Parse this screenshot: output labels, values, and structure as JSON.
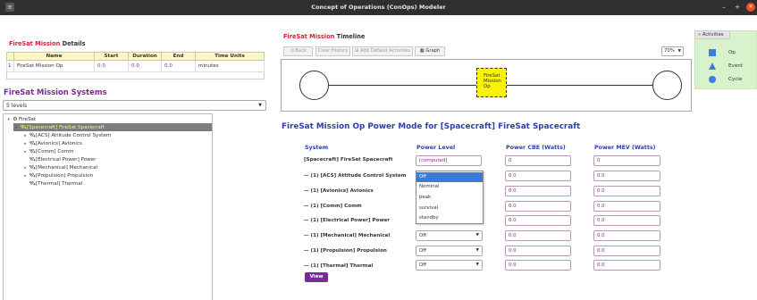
{
  "window": {
    "title": "Concept of Operations (ConOps) Modeler",
    "minimize": "–",
    "maximize": "+",
    "close": "✕"
  },
  "details": {
    "heading_prefix": "FireSat Mission",
    "heading_suffix": "Details",
    "columns": [
      "Name",
      "Start",
      "Duration",
      "End",
      "Time Units"
    ],
    "row": {
      "index": "1",
      "name": "FireSat Mission Op",
      "start": "0.0",
      "duration": "0.0",
      "end": "0.0",
      "units": "minutes"
    }
  },
  "systems": {
    "heading": "FireSat Mission Systems",
    "levels": "5 levels",
    "tree": [
      {
        "label": "FireSat",
        "toggle": "▾",
        "icon": "⚙"
      },
      {
        "label": "[Spacecraft] FireSat Spacecraft",
        "toggle": "▾",
        "icon": "🛰"
      },
      {
        "label": "[ACS] Attitude Control System",
        "toggle": "▸",
        "icon": "🛰"
      },
      {
        "label": "[Avionics] Avionics",
        "toggle": "▸",
        "icon": "🛰"
      },
      {
        "label": "[Comm] Comm",
        "toggle": "▸",
        "icon": "🛰"
      },
      {
        "label": "[Electrical Power] Power",
        "toggle": "",
        "icon": "🛰"
      },
      {
        "label": "[Mechanical] Mechanical",
        "toggle": "▸",
        "icon": "🛰"
      },
      {
        "label": "[Propulsion] Propulsion",
        "toggle": "▸",
        "icon": "🛰"
      },
      {
        "label": "[Thermal] Thermal",
        "toggle": "",
        "icon": "🛰"
      }
    ]
  },
  "timeline": {
    "heading_prefix": "FireSat Mission",
    "heading_suffix": "Timeline",
    "buttons": {
      "back": "Back",
      "clear": "Clear History",
      "add": "Add Default Activities",
      "graph": "Graph"
    },
    "zoom": "70%",
    "activity": [
      "FireSat",
      "Mission",
      "Op"
    ]
  },
  "palette": {
    "tab": "Activities",
    "items": [
      "Op",
      "Event",
      "Cycle"
    ]
  },
  "power_mode": {
    "heading": "FireSat Mission Op Power Mode for [Spacecraft] FireSat Spacecraft",
    "col_system": "System",
    "col_level": "Power Level",
    "col_cbe": "Power CBE (Watts)",
    "col_mev": "Power MEV (Watts)",
    "rows": [
      {
        "system": "[Spacecraft] FireSat Spacecraft",
        "level": "[computed]",
        "cbe": "0",
        "mev": "0"
      },
      {
        "system": "— (1) [ACS] Attitude Control System",
        "level": "Off",
        "cbe": "0.0",
        "mev": "0.0"
      },
      {
        "system": "— (1) [Avionics] Avionics",
        "level": "Off",
        "cbe": "0.0",
        "mev": "0.0"
      },
      {
        "system": "— (1) [Comm] Comm",
        "level": "Off",
        "cbe": "0.0",
        "mev": "0.0"
      },
      {
        "system": "— (1) [Electrical Power] Power",
        "level": "Off",
        "cbe": "0.0",
        "mev": "0.0"
      },
      {
        "system": "— (1) [Mechanical] Mechanical",
        "level": "Off",
        "cbe": "0.0",
        "mev": "0.0"
      },
      {
        "system": "— (1) [Propulsion] Propulsion",
        "level": "Off",
        "cbe": "0.0",
        "mev": "0.0"
      },
      {
        "system": "— (1) [Thermal] Thermal",
        "level": "Off",
        "cbe": "0.0",
        "mev": "0.0"
      }
    ],
    "dropdown_options": [
      "Off",
      "Nominal",
      "peak",
      "survival",
      "standby"
    ],
    "view_button": "View"
  }
}
